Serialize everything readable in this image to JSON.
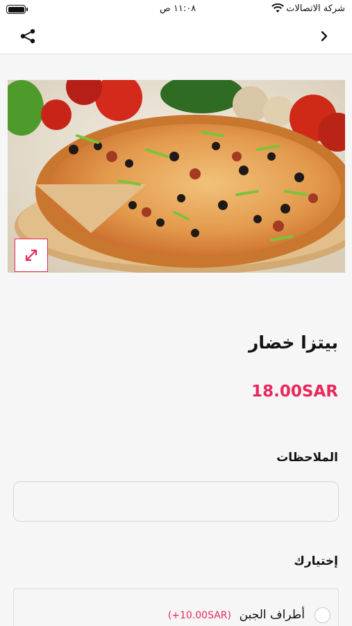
{
  "status_bar": {
    "carrier": "شركة الاتصالات",
    "time": "١١:٠٨ ص"
  },
  "nav": {
    "share_icon": "share-icon",
    "back_icon": "chevron-right-icon"
  },
  "hero": {
    "image_subject": "pizza",
    "expand_icon": "expand-arrows-icon"
  },
  "product": {
    "name": "بيتزا خضار",
    "price": "18.00SAR"
  },
  "notes": {
    "label": "الملاحظات",
    "placeholder": ""
  },
  "choices": {
    "label": "إختيارك",
    "options": [
      {
        "name": "أطراف الجبن",
        "price": "(+10.00SAR)",
        "selected": false
      }
    ]
  },
  "colors": {
    "accent": "#e8285c",
    "background": "#f6f6f6"
  }
}
